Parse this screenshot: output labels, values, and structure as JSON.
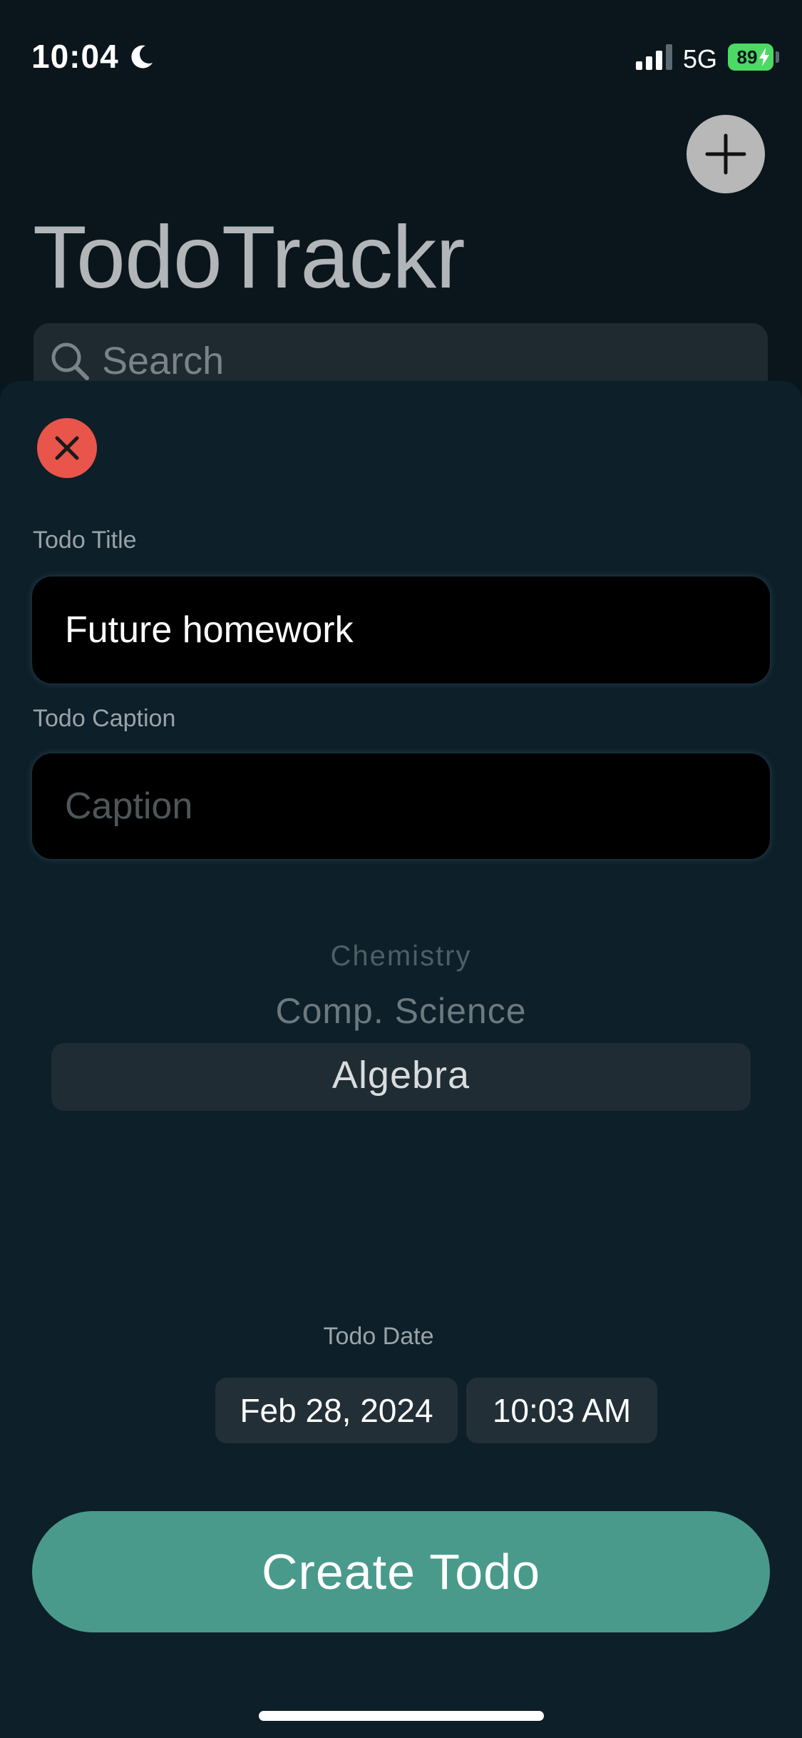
{
  "status_bar": {
    "time": "10:04",
    "network": "5G",
    "battery": "89",
    "icons": [
      "moon-icon",
      "signal-icon",
      "battery-icon",
      "charging-bolt-icon"
    ]
  },
  "header": {
    "title": "TodoTrackr",
    "add_icon": "plus-icon"
  },
  "search": {
    "placeholder": "Search",
    "icon": "search-icon"
  },
  "sheet": {
    "close_icon": "close-icon",
    "title_field": {
      "label": "Todo Title",
      "value": "Future homework"
    },
    "caption_field": {
      "label": "Todo Caption",
      "placeholder": "Caption"
    },
    "subject_picker": {
      "options": [
        "Chemistry",
        "Comp. Science",
        "Algebra"
      ],
      "selected": "Algebra"
    },
    "date_field": {
      "label": "Todo Date",
      "date": "Feb 28, 2024",
      "time": "10:03 AM"
    },
    "submit_label": "Create Todo"
  },
  "colors": {
    "background": "#0a161c",
    "sheet": "#0d1f28",
    "accent": "#4a9a8c",
    "close": "#e9554a",
    "battery": "#4cd964"
  }
}
